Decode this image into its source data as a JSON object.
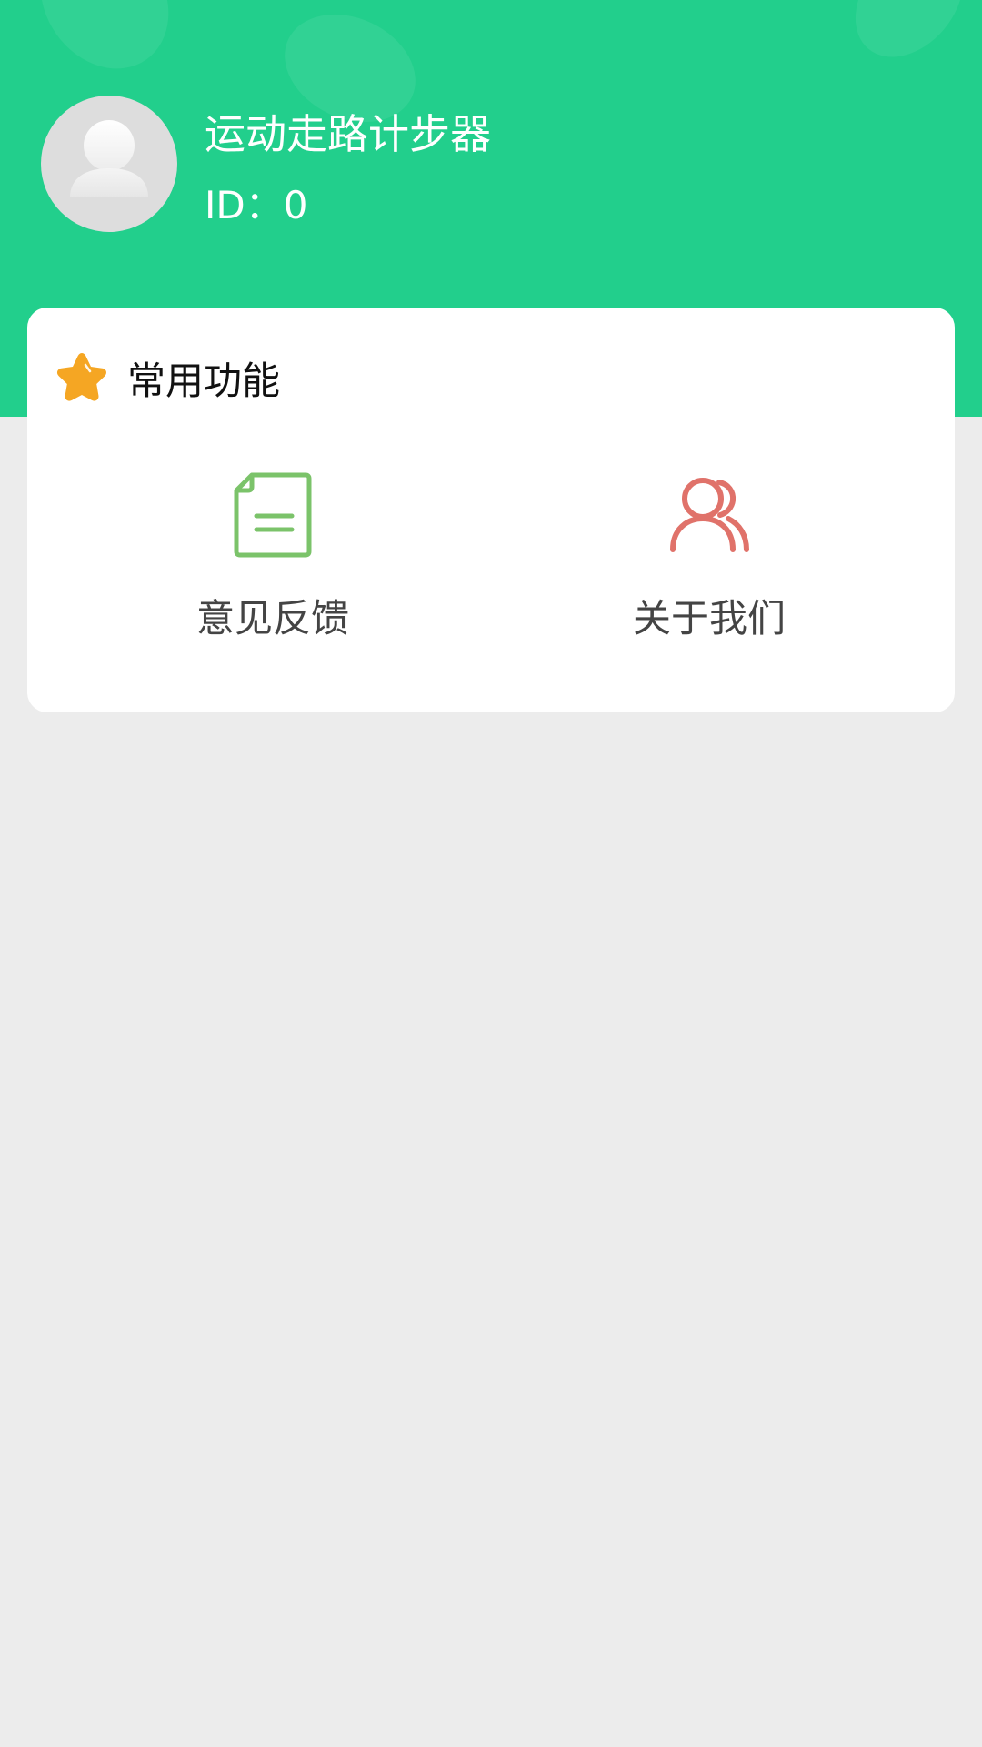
{
  "header": {
    "app_name": "运动走路计步器",
    "user_id": "ID：0"
  },
  "colors": {
    "header_bg": "#22cf8c",
    "page_bg": "#ececec",
    "star": "#f5a623",
    "feedback_icon": "#7bc36a",
    "about_icon": "#e0726a"
  },
  "common_functions": {
    "title": "常用功能",
    "title_icon": "star-icon",
    "items": [
      {
        "label": "意见反馈",
        "icon": "document-icon"
      },
      {
        "label": "关于我们",
        "icon": "users-icon"
      }
    ]
  }
}
